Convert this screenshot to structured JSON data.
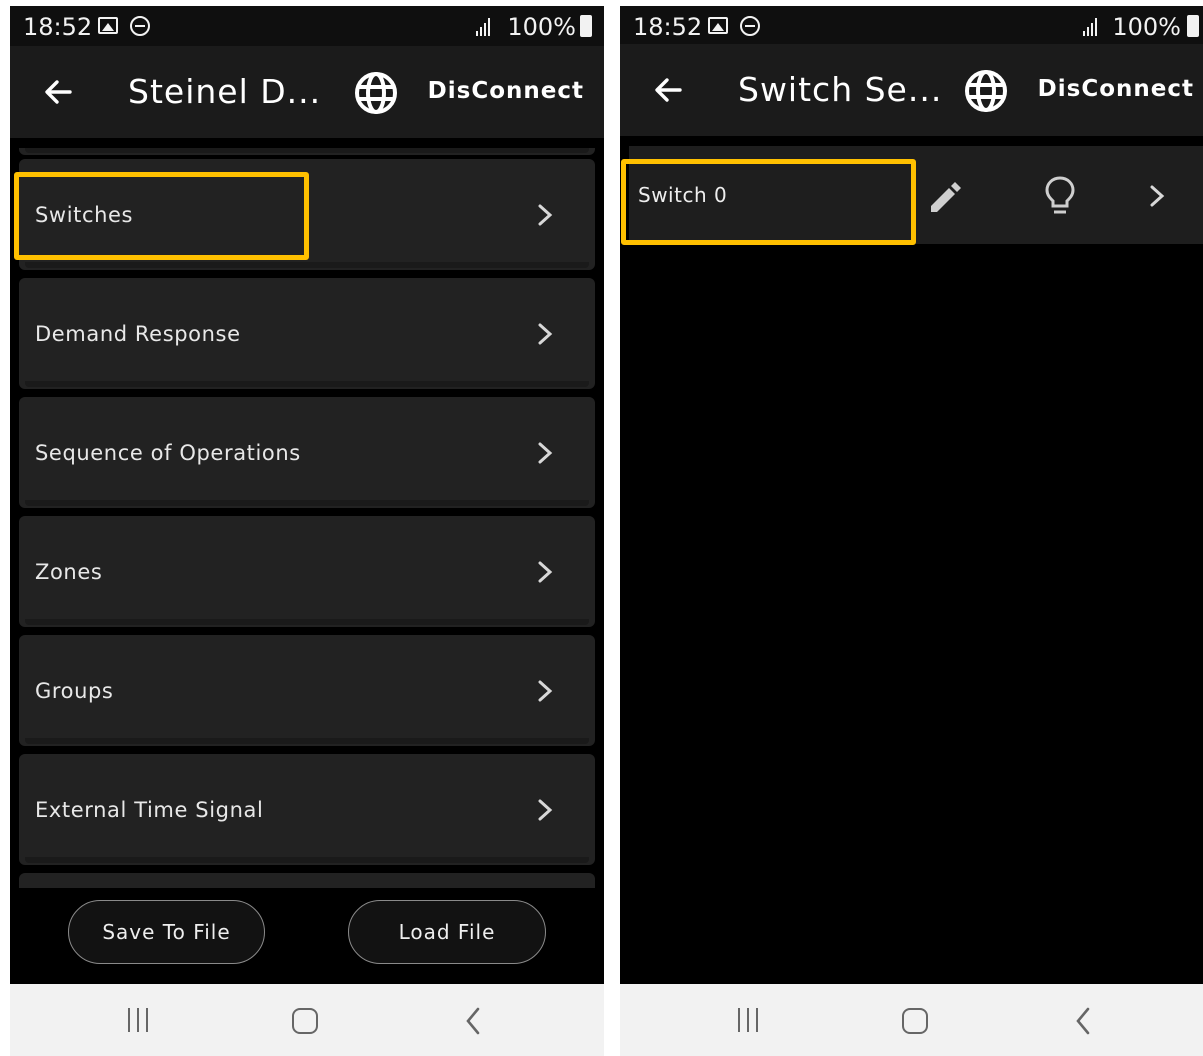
{
  "left_screen": {
    "status_bar": {
      "time": "18:52",
      "battery": "100%"
    },
    "app_bar": {
      "title": "Steinel D...",
      "action_label": "DisConnect"
    },
    "menu_items": [
      {
        "label": "Switches"
      },
      {
        "label": "Demand Response"
      },
      {
        "label": "Sequence of Operations"
      },
      {
        "label": "Zones"
      },
      {
        "label": "Groups"
      },
      {
        "label": "External Time Signal"
      }
    ],
    "buttons": {
      "save": "Save To File",
      "load": "Load File"
    }
  },
  "right_screen": {
    "status_bar": {
      "time": "18:52",
      "battery": "100%"
    },
    "app_bar": {
      "title": "Switch Se...",
      "action_label": "DisConnect"
    },
    "switch_row": {
      "label": "Switch 0"
    }
  },
  "colors": {
    "highlight": "#ffc000",
    "background": "#000000",
    "appbar": "#1b1b1b",
    "card": "#222222"
  },
  "icons": [
    "back-arrow-icon",
    "globe-icon",
    "chevron-right-icon",
    "pencil-icon",
    "lightbulb-icon",
    "gallery-icon",
    "dnd-icon",
    "signal-icon",
    "battery-icon",
    "recents-icon",
    "home-icon",
    "nav-back-icon"
  ]
}
